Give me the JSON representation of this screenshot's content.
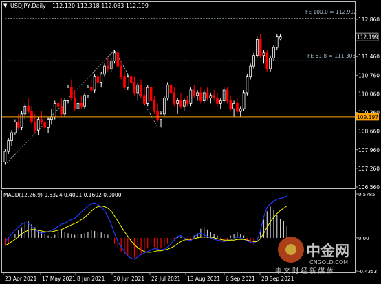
{
  "header": {
    "symbol": "USDJPY,Daily",
    "ohlc": "112.120 112.318 112.083 112.199"
  },
  "colors": {
    "background": "#000000",
    "frame": "#c0c0c0",
    "bull_candle": "#ffffff",
    "bear_candle": "#ff0000",
    "level_line": "#ffa500",
    "fib_line": "#9fb8c8",
    "macd_signal": "#ffff00",
    "macd_line": "#1e3cff",
    "macd_hist_pos": "#c8c8c8",
    "macd_hist_neg": "#ff0000"
  },
  "fib": {
    "fe_100_label": "FE 100.0 = 112.902",
    "fe_618_label": "FE 61.8 = 111.303"
  },
  "price_axis": {
    "ticks": [
      "112.860",
      "112.199",
      "111.460",
      "110.760",
      "110.060",
      "109.360",
      "109.197",
      "108.660",
      "107.960",
      "107.260",
      "106.560"
    ],
    "current_price": "112.199",
    "support_level": "109.197"
  },
  "macd": {
    "label": "MACD(12,26,9) 0.5324 0.4091 0.1602 0.0000",
    "ticks": [
      "0.5785",
      "0.00",
      "-0.4353"
    ]
  },
  "date_axis": {
    "labels": [
      "23 Apr 2021",
      "17 May 2021",
      "8 Jun 2021",
      "30 Jun 2021",
      "22 Jul 2021",
      "13 Aug 2021",
      "6 Sep 2021",
      "28 Sep 2021"
    ]
  },
  "watermark": {
    "brand": "中金网",
    "domain": "CNGOLD.COM",
    "tagline": "中 文 财 经 新 媒 体"
  },
  "chart_data": {
    "type": "candlestick",
    "title": "USDJPY,Daily",
    "ylim": [
      106.56,
      112.86
    ],
    "ohlc_points": [
      [
        107.5,
        108.0,
        107.4,
        107.9
      ],
      [
        107.9,
        108.4,
        107.8,
        108.3
      ],
      [
        108.3,
        108.7,
        108.1,
        108.6
      ],
      [
        108.6,
        109.1,
        108.5,
        109.0
      ],
      [
        109.0,
        109.3,
        108.7,
        108.8
      ],
      [
        108.8,
        109.4,
        108.7,
        109.3
      ],
      [
        109.3,
        109.7,
        109.1,
        109.6
      ],
      [
        109.6,
        109.9,
        109.3,
        109.4
      ],
      [
        109.4,
        109.6,
        108.9,
        109.0
      ],
      [
        109.0,
        109.3,
        108.6,
        108.7
      ],
      [
        108.7,
        109.2,
        108.5,
        109.1
      ],
      [
        109.1,
        109.4,
        108.9,
        109.0
      ],
      [
        109.0,
        109.3,
        108.7,
        108.8
      ],
      [
        108.8,
        109.2,
        108.6,
        109.1
      ],
      [
        109.1,
        109.5,
        108.9,
        109.2
      ],
      [
        109.2,
        109.8,
        109.1,
        109.7
      ],
      [
        109.7,
        110.0,
        109.5,
        109.6
      ],
      [
        109.6,
        109.9,
        109.2,
        109.3
      ],
      [
        109.3,
        109.9,
        109.2,
        109.8
      ],
      [
        109.8,
        110.4,
        109.7,
        110.3
      ],
      [
        110.3,
        110.6,
        109.8,
        109.9
      ],
      [
        109.9,
        110.2,
        109.4,
        109.5
      ],
      [
        109.5,
        109.8,
        109.2,
        109.7
      ],
      [
        109.7,
        110.0,
        109.5,
        109.6
      ],
      [
        109.6,
        110.1,
        109.5,
        110.0
      ],
      [
        110.0,
        110.4,
        109.9,
        110.3
      ],
      [
        110.3,
        110.6,
        110.1,
        110.2
      ],
      [
        110.2,
        110.8,
        110.1,
        110.7
      ],
      [
        110.7,
        111.0,
        110.4,
        110.5
      ],
      [
        110.5,
        110.9,
        110.3,
        110.8
      ],
      [
        110.8,
        111.2,
        110.7,
        111.1
      ],
      [
        111.1,
        111.4,
        110.9,
        111.0
      ],
      [
        111.0,
        111.4,
        110.9,
        111.3
      ],
      [
        111.3,
        111.7,
        111.2,
        111.6
      ],
      [
        111.6,
        111.7,
        111.0,
        111.1
      ],
      [
        111.1,
        111.3,
        110.6,
        110.7
      ],
      [
        110.7,
        110.9,
        110.2,
        110.3
      ],
      [
        110.3,
        110.8,
        110.2,
        110.7
      ],
      [
        110.7,
        110.9,
        110.4,
        110.5
      ],
      [
        110.5,
        110.7,
        110.0,
        110.1
      ],
      [
        110.1,
        110.5,
        109.8,
        110.4
      ],
      [
        110.4,
        110.6,
        109.9,
        110.0
      ],
      [
        110.0,
        110.3,
        109.6,
        109.7
      ],
      [
        109.7,
        110.4,
        109.6,
        110.3
      ],
      [
        110.3,
        110.4,
        109.7,
        109.8
      ],
      [
        109.8,
        110.0,
        109.3,
        109.4
      ],
      [
        109.4,
        109.7,
        109.0,
        109.1
      ],
      [
        109.1,
        109.4,
        108.8,
        109.3
      ],
      [
        109.3,
        110.0,
        109.2,
        109.9
      ],
      [
        109.9,
        110.5,
        109.8,
        110.4
      ],
      [
        110.4,
        110.6,
        110.0,
        110.1
      ],
      [
        110.1,
        110.3,
        109.6,
        109.7
      ],
      [
        109.7,
        109.9,
        109.3,
        109.8
      ],
      [
        109.8,
        110.1,
        109.5,
        109.6
      ],
      [
        109.6,
        109.9,
        109.4,
        109.8
      ],
      [
        109.8,
        110.0,
        109.6,
        109.7
      ],
      [
        109.7,
        110.3,
        109.6,
        110.2
      ],
      [
        110.2,
        110.4,
        109.9,
        110.0
      ],
      [
        110.0,
        110.2,
        109.8,
        110.1
      ],
      [
        110.1,
        110.3,
        109.7,
        109.8
      ],
      [
        109.8,
        110.2,
        109.7,
        110.1
      ],
      [
        110.1,
        110.3,
        109.8,
        109.9
      ],
      [
        109.9,
        110.1,
        109.7,
        110.0
      ],
      [
        110.0,
        110.2,
        109.8,
        109.9
      ],
      [
        109.9,
        110.1,
        109.6,
        109.7
      ],
      [
        109.7,
        109.9,
        109.5,
        109.8
      ],
      [
        109.8,
        110.3,
        109.7,
        110.2
      ],
      [
        110.2,
        110.3,
        109.7,
        109.8
      ],
      [
        109.8,
        110.0,
        109.4,
        109.5
      ],
      [
        109.5,
        109.8,
        109.2,
        109.7
      ],
      [
        109.7,
        109.9,
        109.3,
        109.4
      ],
      [
        109.4,
        109.6,
        109.2,
        109.5
      ],
      [
        109.5,
        110.2,
        109.4,
        110.1
      ],
      [
        110.1,
        110.8,
        110.0,
        110.7
      ],
      [
        110.7,
        111.2,
        110.6,
        111.1
      ],
      [
        111.1,
        111.6,
        111.0,
        111.5
      ],
      [
        111.5,
        112.2,
        111.4,
        112.1
      ],
      [
        112.1,
        112.3,
        111.4,
        111.5
      ],
      [
        111.5,
        111.7,
        111.2,
        111.6
      ],
      [
        111.6,
        111.7,
        110.9,
        111.0
      ],
      [
        111.0,
        111.5,
        110.9,
        111.4
      ],
      [
        111.4,
        111.9,
        111.3,
        111.8
      ],
      [
        111.8,
        112.3,
        111.7,
        112.2
      ],
      [
        112.12,
        112.32,
        112.08,
        112.2
      ]
    ],
    "levels": [
      {
        "name": "FE 100.0",
        "value": 112.902
      },
      {
        "name": "FE 61.8",
        "value": 111.303
      },
      {
        "name": "support",
        "value": 109.197
      }
    ],
    "macd_series": {
      "ylim": [
        -0.4353,
        0.5785
      ],
      "histogram": [
        -0.1,
        -0.08,
        0.0,
        0.05,
        0.1,
        0.14,
        0.19,
        0.22,
        0.18,
        0.14,
        0.1,
        0.08,
        0.05,
        0.03,
        0.02,
        0.04,
        0.08,
        0.1,
        0.08,
        0.06,
        0.05,
        0.04,
        0.04,
        0.05,
        0.06,
        0.08,
        0.1,
        0.09,
        0.08,
        0.07,
        0.05,
        0.04,
        -0.02,
        -0.08,
        -0.13,
        -0.18,
        -0.21,
        -0.24,
        -0.27,
        -0.26,
        -0.24,
        -0.21,
        -0.18,
        -0.14,
        -0.1,
        -0.12,
        -0.15,
        -0.14,
        -0.12,
        -0.08,
        -0.04,
        -0.02,
        0.01,
        0.02,
        -0.02,
        -0.03,
        -0.05,
        0.03,
        0.06,
        0.12,
        0.14,
        0.11,
        0.08,
        0.05,
        0.03,
        -0.05,
        -0.04,
        -0.03,
        0.03,
        0.05,
        0.07,
        0.05,
        0.03,
        -0.04,
        -0.07,
        -0.09,
        -0.05,
        0.08,
        0.24,
        0.35,
        0.41,
        0.37,
        0.3,
        0.25,
        0.22,
        0.16
      ],
      "macd": [
        -0.05,
        0.0,
        0.05,
        0.1,
        0.14,
        0.18,
        0.2,
        0.19,
        0.15,
        0.11,
        0.08,
        0.06,
        0.07,
        0.08,
        0.1,
        0.12,
        0.15,
        0.18,
        0.19,
        0.22,
        0.24,
        0.26,
        0.3,
        0.34,
        0.38,
        0.42,
        0.45,
        0.46,
        0.44,
        0.4,
        0.36,
        0.28,
        0.18,
        0.06,
        -0.05,
        -0.12,
        -0.18,
        -0.24,
        -0.27,
        -0.28,
        -0.25,
        -0.22,
        -0.2,
        -0.18,
        -0.16,
        -0.14,
        -0.15,
        -0.16,
        -0.15,
        -0.12,
        -0.08,
        -0.03,
        0.02,
        0.03,
        0.0,
        -0.03,
        -0.04,
        0.01,
        0.05,
        0.06,
        0.04,
        0.02,
        0.0,
        -0.02,
        -0.03,
        -0.04,
        -0.05,
        -0.04,
        -0.03,
        -0.01,
        0.02,
        0.0,
        -0.02,
        -0.04,
        -0.06,
        -0.07,
        -0.04,
        0.1,
        0.28,
        0.4,
        0.45,
        0.48,
        0.51,
        0.52,
        0.53,
        0.55
      ],
      "signal": [
        -0.1,
        -0.08,
        -0.05,
        -0.02,
        0.02,
        0.05,
        0.08,
        0.1,
        0.11,
        0.11,
        0.1,
        0.09,
        0.08,
        0.08,
        0.08,
        0.09,
        0.1,
        0.11,
        0.13,
        0.15,
        0.17,
        0.19,
        0.21,
        0.24,
        0.27,
        0.31,
        0.35,
        0.39,
        0.41,
        0.42,
        0.41,
        0.39,
        0.35,
        0.29,
        0.22,
        0.15,
        0.08,
        0.02,
        -0.04,
        -0.09,
        -0.13,
        -0.16,
        -0.18,
        -0.19,
        -0.19,
        -0.18,
        -0.17,
        -0.17,
        -0.16,
        -0.15,
        -0.13,
        -0.11,
        -0.08,
        -0.05,
        -0.03,
        -0.02,
        -0.02,
        -0.01,
        0.0,
        0.01,
        0.01,
        0.01,
        0.01,
        0.0,
        -0.01,
        -0.02,
        -0.03,
        -0.03,
        -0.03,
        -0.03,
        -0.02,
        -0.02,
        -0.02,
        -0.03,
        -0.04,
        -0.05,
        -0.05,
        -0.01,
        0.06,
        0.14,
        0.21,
        0.27,
        0.32,
        0.36,
        0.39,
        0.42
      ]
    }
  }
}
